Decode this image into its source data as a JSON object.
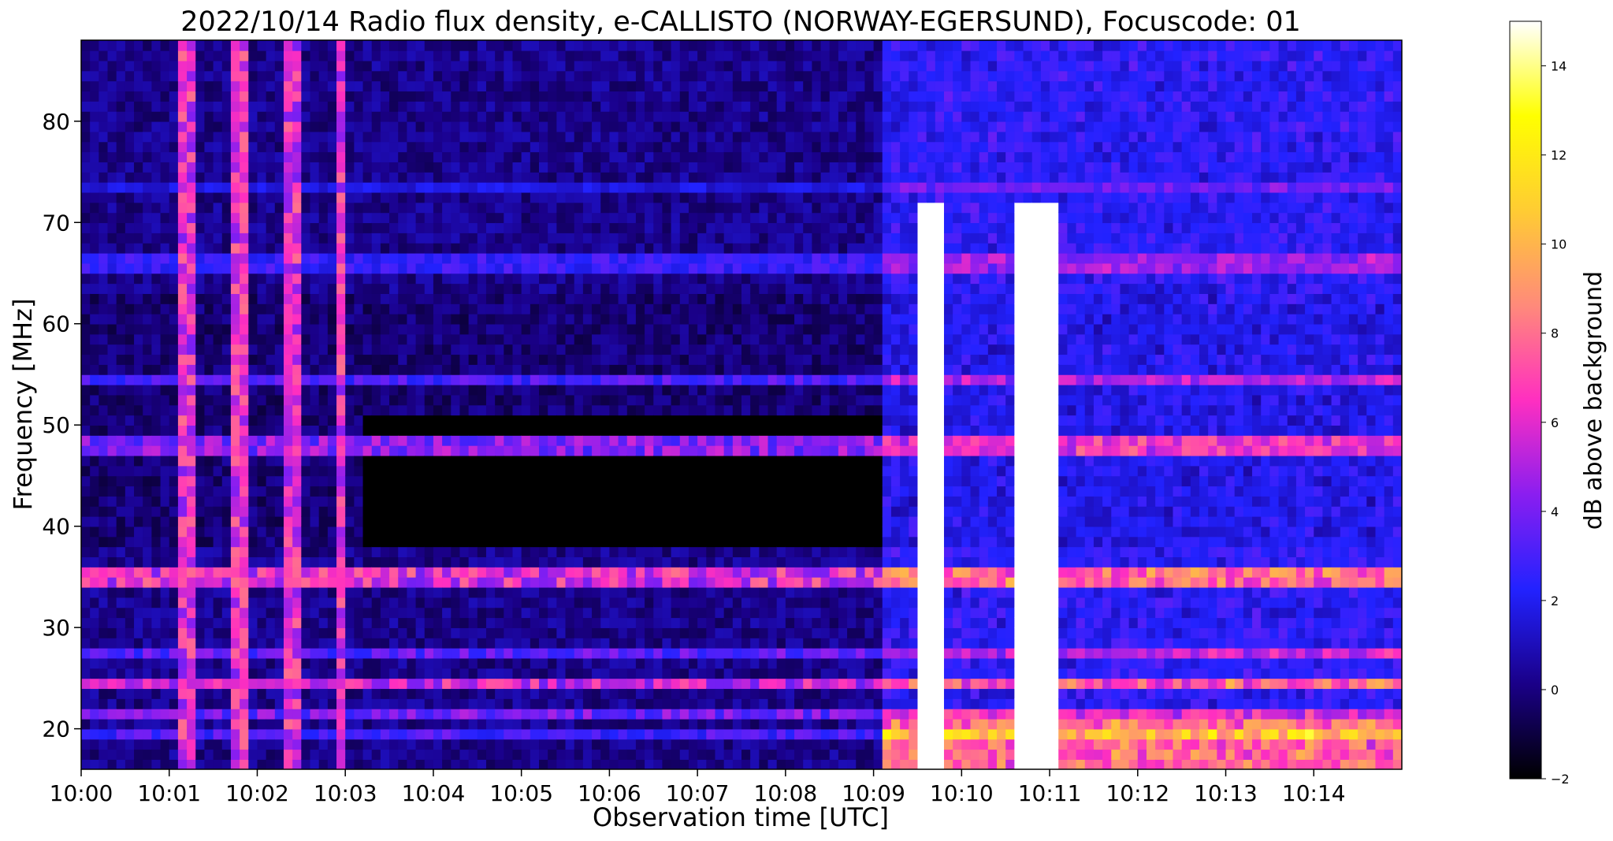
{
  "chart_data": {
    "type": "heatmap",
    "title": "2022/10/14  Radio flux density, e-CALLISTO (NORWAY-EGERSUND), Focuscode: 01",
    "xlabel": "Observation time [UTC]",
    "ylabel": "Frequency [MHz]",
    "x_ticks": [
      "10:00",
      "10:01",
      "10:02",
      "10:03",
      "10:04",
      "10:05",
      "10:06",
      "10:07",
      "10:08",
      "10:09",
      "10:10",
      "10:11",
      "10:12",
      "10:13",
      "10:14"
    ],
    "x_range_minutes": [
      0,
      15
    ],
    "y_ticks": [
      20,
      30,
      40,
      50,
      60,
      70,
      80
    ],
    "ylim": [
      16,
      88
    ],
    "colorbar": {
      "label": "dB above background",
      "range": [
        -2,
        15
      ],
      "ticks": [
        -2,
        0,
        2,
        4,
        6,
        8,
        10,
        12,
        14
      ],
      "colormap": [
        "#000000",
        "#1a0088",
        "#2222ff",
        "#8a1ef0",
        "#ff2fc0",
        "#ff8a7a",
        "#ffcc33",
        "#ffff00",
        "#ffffff"
      ]
    },
    "features": {
      "persistent_bands_mhz": [
        {
          "f1": 71.3,
          "f2": 72.4,
          "db": -1.5
        },
        {
          "f1": 72.6,
          "f2": 74.0,
          "db": 2.0
        },
        {
          "f1": 65.5,
          "f2": 66.8,
          "db": 3.0
        },
        {
          "f1": 54.0,
          "f2": 55.0,
          "db": 3.5
        },
        {
          "f1": 47.5,
          "f2": 48.5,
          "db": 5.0
        },
        {
          "f1": 34.5,
          "f2": 35.6,
          "db": 7.0
        },
        {
          "f1": 36.6,
          "f2": 37.4,
          "db": 3.0
        },
        {
          "f1": 27.3,
          "f2": 28.1,
          "db": 4.0
        },
        {
          "f1": 24.3,
          "f2": 25.2,
          "db": 6.5
        },
        {
          "f1": 21.5,
          "f2": 22.3,
          "db": 4.5
        },
        {
          "f1": 19.3,
          "f2": 20.2,
          "db": 3.5
        }
      ],
      "quiet_region": {
        "t1": 3.2,
        "t2": 9.1,
        "f1": 38,
        "f2": 51,
        "db": -2
      },
      "active_region_start_min": 9.12,
      "broadband_bursts": [
        {
          "t1": 9.55,
          "t2": 9.65,
          "db": 15
        },
        {
          "t1": 9.74,
          "t2": 9.83,
          "db": 15
        },
        {
          "t1": 10.65,
          "t2": 11.12,
          "db": 15
        }
      ],
      "vertical_streaks_min": [
        1.12,
        1.21,
        1.71,
        1.82,
        1.88,
        2.32,
        2.47,
        2.95
      ]
    }
  }
}
